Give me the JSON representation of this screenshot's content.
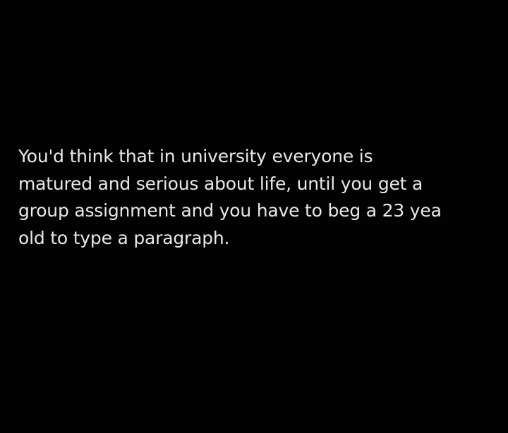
{
  "colors": {
    "background": "#020202",
    "text": "#e9e9e9"
  },
  "post": {
    "lines": [
      "You'd think that in university everyone is",
      "matured and serious about life, until you get a",
      "group assignment and you have to beg a 23 yea",
      "old to type a paragraph."
    ]
  }
}
